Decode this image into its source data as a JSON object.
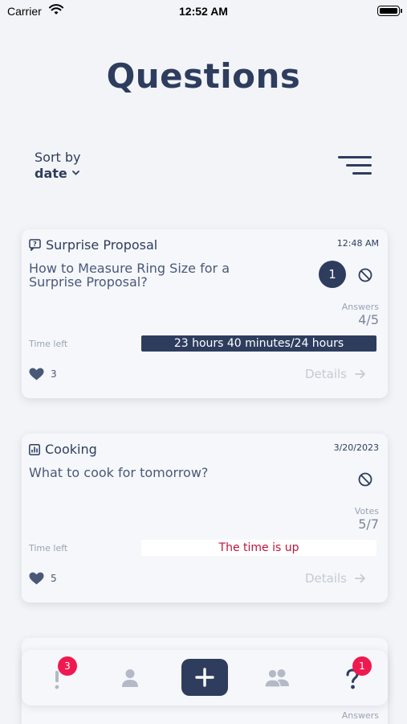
{
  "status_bar": {
    "carrier": "Carrier",
    "time": "12:52 AM"
  },
  "page": {
    "title": "Questions"
  },
  "sort": {
    "label": "Sort by",
    "value": "date"
  },
  "cards": [
    {
      "category": "Surprise Proposal",
      "category_icon": "question-bubble-icon",
      "date": "12:48 AM",
      "question": "How to Measure Ring Size for a Surprise Proposal?",
      "badge": "1",
      "count_label": "Answers",
      "count": "4/5",
      "time_left_label": "Time left",
      "time_left": "23 hours 40 minutes/24 hours",
      "likes": "3",
      "details_label": "Details"
    },
    {
      "category": "Cooking",
      "category_icon": "poll-chart-icon",
      "date": "3/20/2023",
      "question": "What to cook for tomorrow?",
      "count_label": "Votes",
      "count": "5/7",
      "time_left_label": "Time left",
      "time_left": "The time is up",
      "likes": "5",
      "details_label": "Details"
    }
  ],
  "peek_card": {
    "count_label": "Answers"
  },
  "tabbar": {
    "alerts_badge": "3",
    "help_badge": "1"
  },
  "colors": {
    "primary": "#2e3d5e",
    "background": "#f2f4f7",
    "badge": "#ef1950",
    "expired": "#c0143c"
  }
}
